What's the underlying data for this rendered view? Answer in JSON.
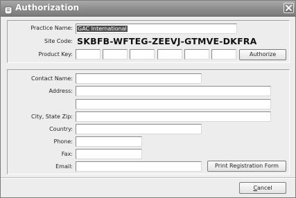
{
  "window": {
    "title": "Authorization"
  },
  "license": {
    "practice_name_label": "Practice Name:",
    "practice_name_value": "GAC International",
    "site_code_label": "Site Code:",
    "site_code_value": "SKBFB-WFTEG-ZEEVJ-GTMVE-DKFRA",
    "product_key_label": "Product Key:",
    "product_key_values": [
      "",
      "",
      "",
      "",
      "",
      ""
    ],
    "authorize_label": "Authorize"
  },
  "contact": {
    "contact_name_label": "Contact Name:",
    "contact_name_value": "",
    "address_label": "Address:",
    "address_line1_value": "",
    "address_line2_value": "",
    "city_state_zip_label": "City, State Zip:",
    "city_state_zip_value": "",
    "country_label": "Country:",
    "country_value": "",
    "phone_label": "Phone:",
    "phone_value": "",
    "fax_label": "Fax:",
    "fax_value": "",
    "email_label": "Email:",
    "email_value": "",
    "print_label": "Print Registration Form"
  },
  "footer": {
    "cancel_mnemonic": "C",
    "cancel_rest": "ancel"
  }
}
